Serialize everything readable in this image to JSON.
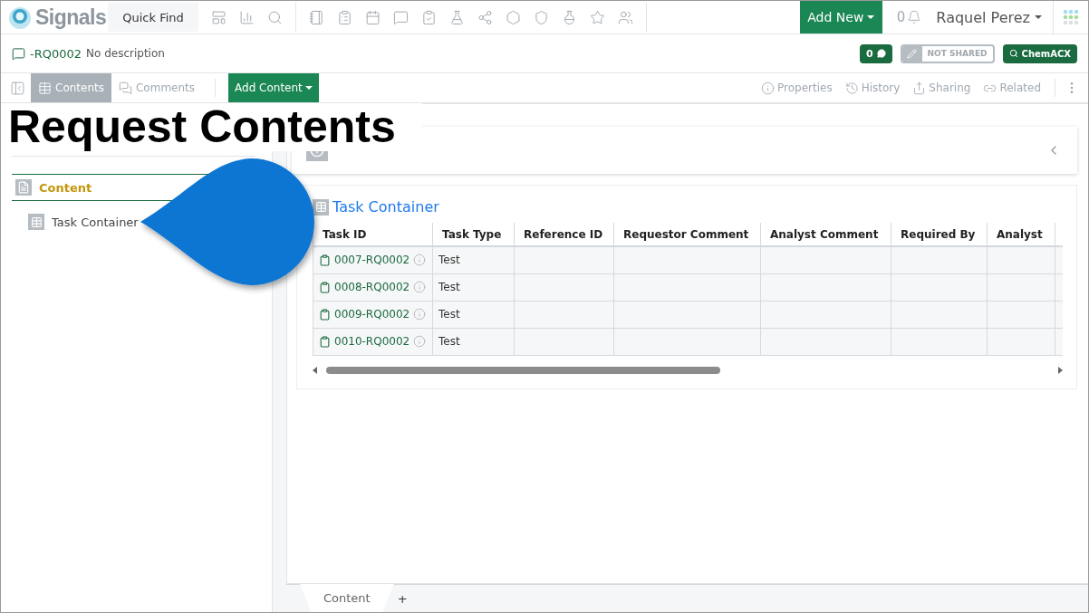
{
  "app": {
    "name": "Signals",
    "quick_find": "Quick Find",
    "add_new": "Add New",
    "notification_count": "0",
    "user": "Raquel Perez"
  },
  "record": {
    "id": "-RQ0002",
    "description": "No description",
    "comment_count": "0",
    "sharing": "NOT SHARED",
    "search_button": "ChemACX"
  },
  "view_tabs": [
    {
      "label": "Contents",
      "selected": true
    },
    {
      "label": "Comments",
      "selected": false
    }
  ],
  "add_content": "Add Content",
  "actions": [
    "Properties",
    "History",
    "Sharing",
    "Related"
  ],
  "caption": "Request Contents",
  "outline": {
    "section": "Content",
    "items": [
      {
        "label": "Task Container"
      }
    ]
  },
  "task_container": {
    "title": "Task Container",
    "columns": [
      "Task ID",
      "Task Type",
      "Reference ID",
      "Requestor Comment",
      "Analyst Comment",
      "Required By",
      "Analyst"
    ],
    "rows": [
      {
        "task_id": "0007-RQ0002",
        "task_type": "Test"
      },
      {
        "task_id": "0008-RQ0002",
        "task_type": "Test"
      },
      {
        "task_id": "0009-RQ0002",
        "task_type": "Test"
      },
      {
        "task_id": "0010-RQ0002",
        "task_type": "Test"
      }
    ]
  },
  "bottom_tabs": [
    {
      "label": "Content",
      "selected": true
    }
  ],
  "add_tab": "+"
}
